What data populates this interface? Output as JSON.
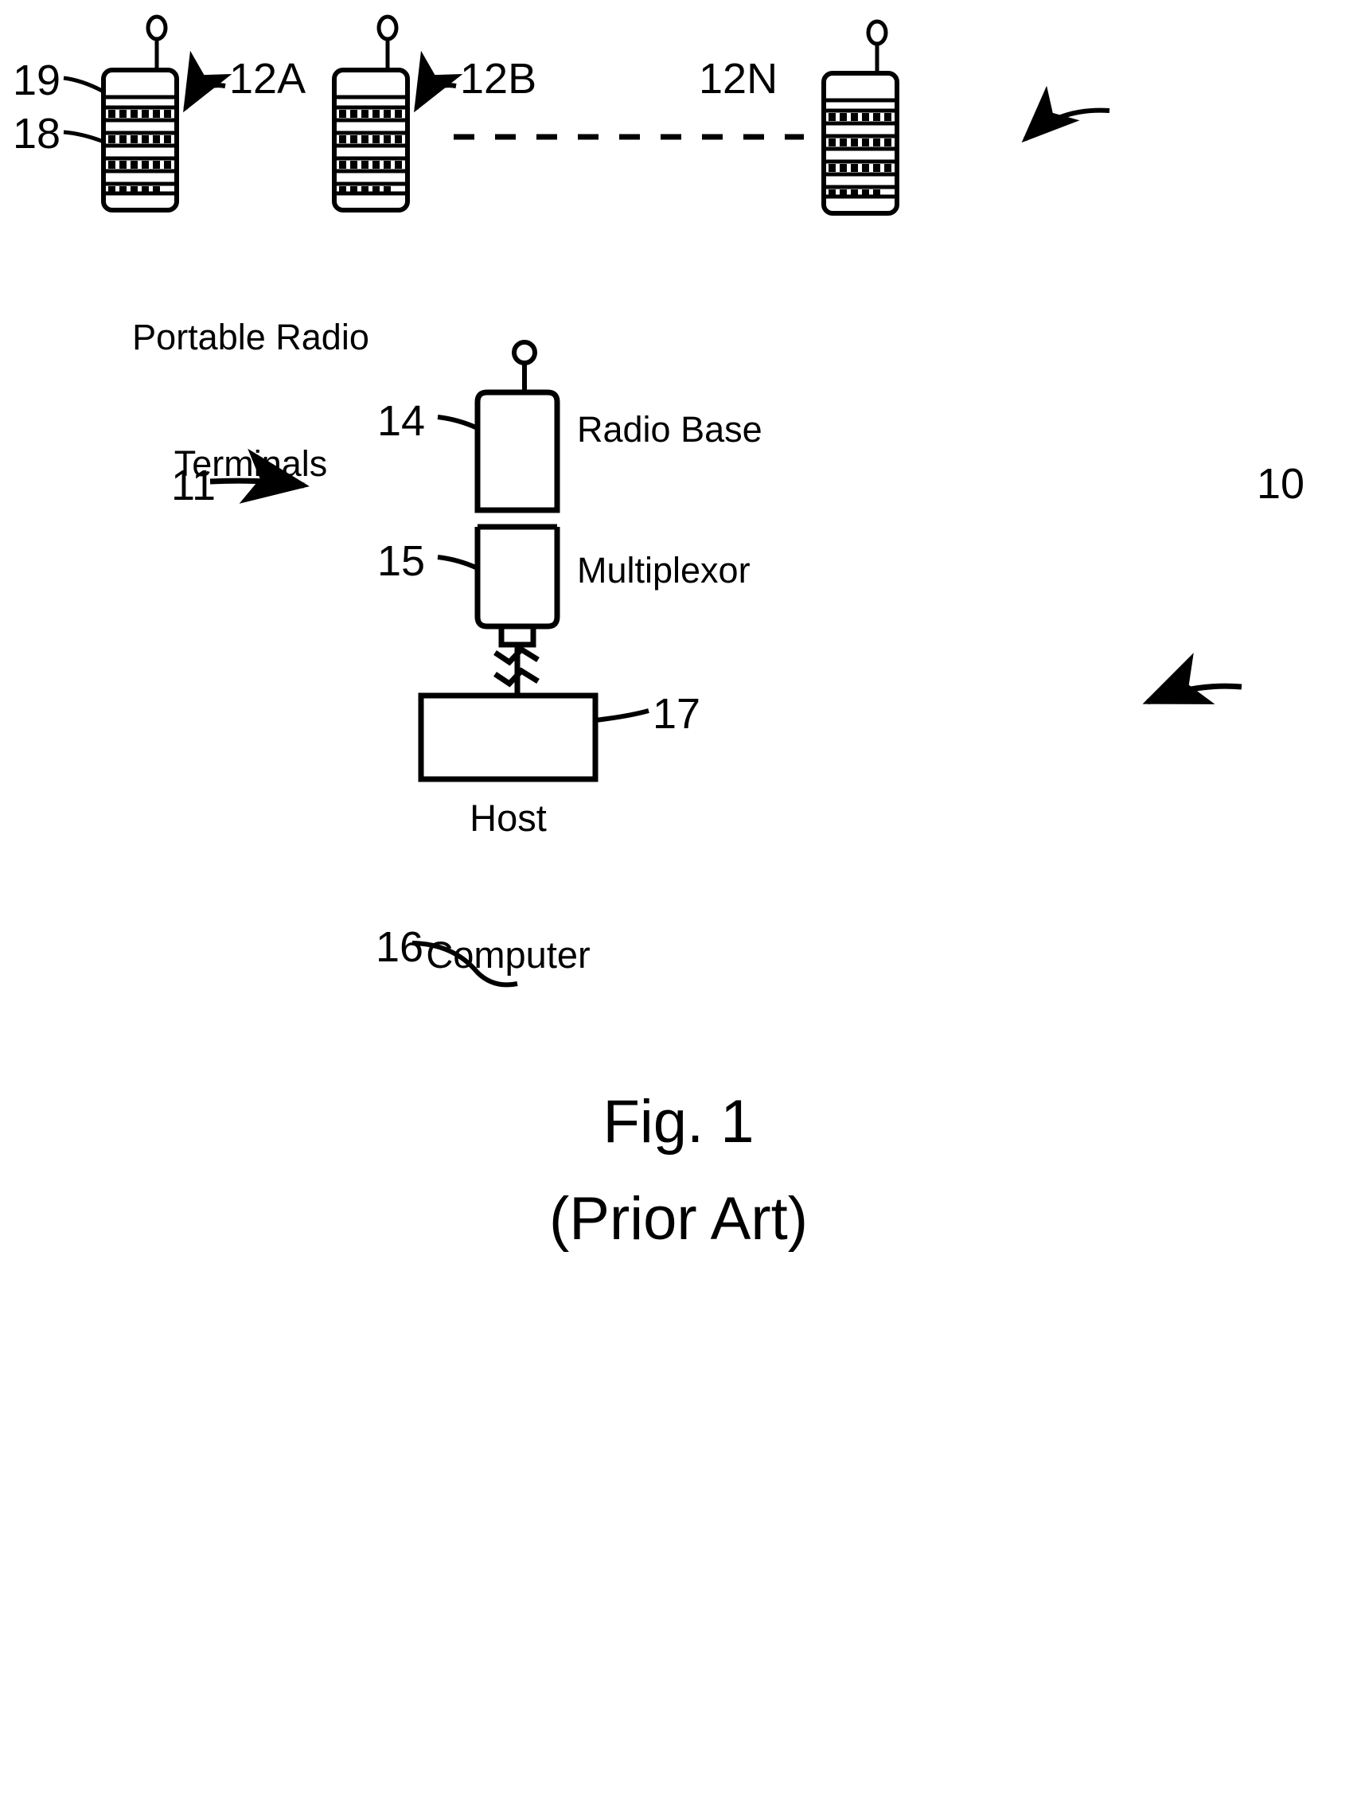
{
  "figure": {
    "title": "Fig. 1",
    "subtitle": "(Prior Art)",
    "system_ref": "10",
    "subsystem_ref": "11"
  },
  "terminals": {
    "group_caption_line1": "Portable Radio",
    "group_caption_line2": "Terminals",
    "antenna_ref": "19",
    "keypad_ref": "18",
    "items": [
      {
        "ref": "12A"
      },
      {
        "ref": "12B"
      },
      {
        "ref": "12N"
      }
    ]
  },
  "base_station": {
    "radio_base_ref": "14",
    "radio_base_label": "Radio Base",
    "multiplexor_ref": "15",
    "multiplexor_label": "Multiplexor",
    "cable_ref": "16"
  },
  "host": {
    "ref": "17",
    "line1": "Host",
    "line2": "Computer"
  },
  "style": {
    "ink": "#000000",
    "paper": "#ffffff"
  }
}
